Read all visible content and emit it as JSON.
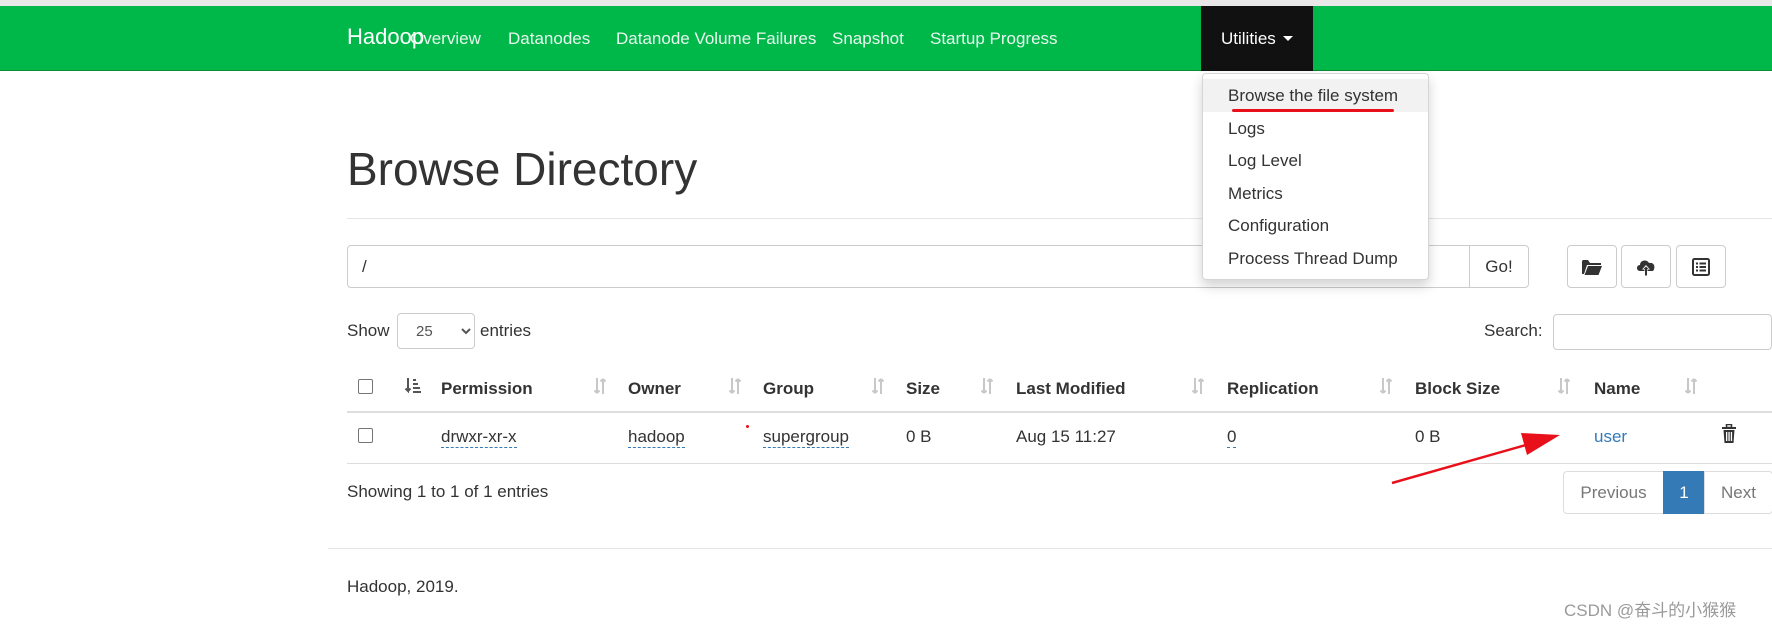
{
  "navbar": {
    "brand": "Hadoop",
    "items": [
      {
        "label": "Overview"
      },
      {
        "label": "Datanodes"
      },
      {
        "label": "Datanode Volume Failures"
      },
      {
        "label": "Snapshot"
      },
      {
        "label": "Startup Progress"
      }
    ],
    "active_item": "Utilities",
    "background_color": "#00b84a"
  },
  "utilities_menu": {
    "items": [
      {
        "label": "Browse the file system",
        "highlighted": true
      },
      {
        "label": "Logs"
      },
      {
        "label": "Log Level"
      },
      {
        "label": "Metrics"
      },
      {
        "label": "Configuration"
      },
      {
        "label": "Process Thread Dump"
      }
    ]
  },
  "page": {
    "title": "Browse Directory",
    "path_value": "/",
    "go_label": "Go!",
    "toolbar_icons": [
      "folder-open-icon",
      "cloud-upload-icon",
      "list-alt-icon"
    ]
  },
  "table_controls": {
    "show_label": "Show",
    "entries_selected": "25",
    "entries_label": "entries",
    "search_label": "Search:"
  },
  "table": {
    "headers": {
      "permission": "Permission",
      "owner": "Owner",
      "group": "Group",
      "size": "Size",
      "last_modified": "Last Modified",
      "replication": "Replication",
      "block_size": "Block Size",
      "name": "Name"
    },
    "rows": [
      {
        "permission": "drwxr-xr-x",
        "owner": "hadoop",
        "group": "supergroup",
        "size": "0 B",
        "last_modified": "Aug 15 11:27",
        "replication": "0",
        "block_size": "0 B",
        "name": "user"
      }
    ]
  },
  "pagination": {
    "info": "Showing 1 to 1 of 1 entries",
    "previous": "Previous",
    "current": "1",
    "next": "Next",
    "accent_color": "#337ab7"
  },
  "footer": {
    "text": "Hadoop, 2019."
  },
  "watermark": "CSDN @奋斗的小猴猴",
  "annotation_color": "#e8101a"
}
